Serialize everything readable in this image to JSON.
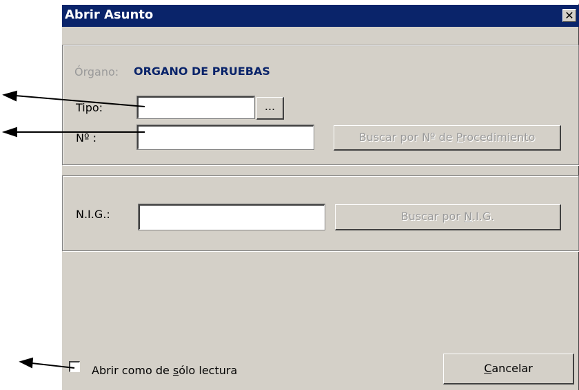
{
  "window": {
    "title": "Abrir Asunto",
    "close_glyph": "✕"
  },
  "organo": {
    "label": "Órgano:",
    "value": "ORGANO DE PRUEBAS"
  },
  "tipo": {
    "label": "Tipo:",
    "value": "",
    "browse_label": "..."
  },
  "numero": {
    "label": "Nº :",
    "value": "",
    "search_button": {
      "pre": "Buscar por Nº de ",
      "accel": "P",
      "post": "rocedimiento"
    }
  },
  "nig": {
    "label": "N.I.G.:",
    "value": "",
    "search_button": {
      "pre": "Buscar por ",
      "accel": "N",
      "post": ".I.G."
    }
  },
  "readonly_checkbox": {
    "pre": "Abrir como de ",
    "accel": "s",
    "post": "ólo lectura",
    "checked": false
  },
  "cancel_button": {
    "accel": "C",
    "post": "ancelar"
  },
  "colors": {
    "title_bar": "#0a246a",
    "dialog_face": "#d4d0c8",
    "organo_value": "#0a246a",
    "disabled_text": "#9a9a9a"
  }
}
